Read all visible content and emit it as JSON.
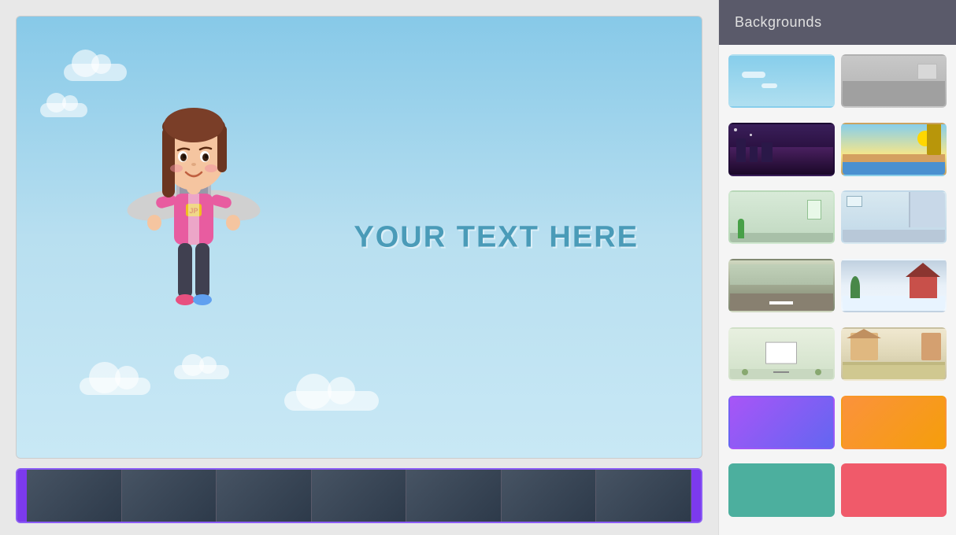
{
  "panel": {
    "title": "Backgrounds"
  },
  "canvas": {
    "text_overlay": "YOUR TEXT HERE"
  },
  "backgrounds": [
    {
      "id": "bg-sky",
      "label": "Sky background",
      "class": "bg-sky",
      "scene": "sky"
    },
    {
      "id": "bg-office-gray",
      "label": "Office gray",
      "class": "bg-office-gray",
      "scene": "office-gray"
    },
    {
      "id": "bg-night-city",
      "label": "Night city",
      "class": "bg-night-city",
      "scene": "night-city"
    },
    {
      "id": "bg-beach",
      "label": "Beach",
      "class": "bg-beach",
      "scene": "beach"
    },
    {
      "id": "bg-office-green",
      "label": "Office green",
      "class": "bg-office-green",
      "scene": "office-green"
    },
    {
      "id": "bg-modern-room",
      "label": "Modern room",
      "class": "bg-modern-room",
      "scene": "modern-room"
    },
    {
      "id": "bg-road",
      "label": "Road",
      "class": "bg-road",
      "scene": "road"
    },
    {
      "id": "bg-winter",
      "label": "Winter",
      "class": "bg-winter",
      "scene": "winter"
    },
    {
      "id": "bg-presentation",
      "label": "Presentation",
      "class": "bg-presentation",
      "scene": "presentation"
    },
    {
      "id": "bg-house-fence",
      "label": "House fence",
      "class": "bg-house-fence",
      "scene": "house-fence"
    },
    {
      "id": "bg-purple-gradient",
      "label": "Purple gradient",
      "class": "bg-purple-gradient",
      "scene": "none"
    },
    {
      "id": "bg-orange-gradient",
      "label": "Orange gradient",
      "class": "bg-orange-gradient",
      "scene": "none"
    },
    {
      "id": "bg-teal-solid",
      "label": "Teal solid",
      "class": "bg-teal-solid",
      "scene": "none"
    },
    {
      "id": "bg-coral-solid",
      "label": "Coral solid",
      "class": "bg-coral-solid",
      "scene": "none"
    }
  ]
}
